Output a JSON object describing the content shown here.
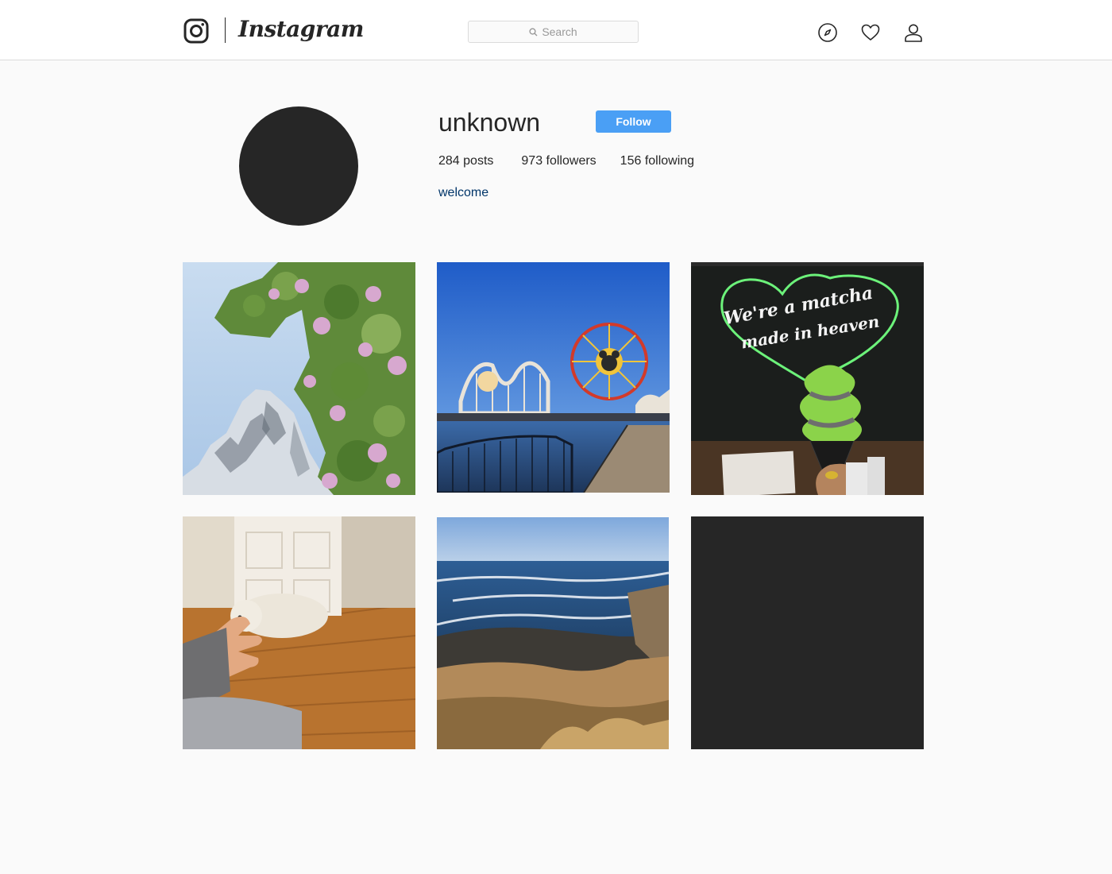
{
  "header": {
    "brand_name": "Instagram",
    "search_placeholder": "Search",
    "icons": [
      "instagram-logo-icon",
      "search-icon",
      "compass-icon",
      "heart-icon",
      "user-icon"
    ]
  },
  "profile": {
    "username": "unknown",
    "follow_label": "Follow",
    "stats": {
      "posts": "284 posts",
      "followers": "973 followers",
      "following": "156 following"
    },
    "bio": "welcome"
  },
  "posts": [
    {
      "subject": "snowy mountain peak with pink blossoms"
    },
    {
      "subject": "amusement park pier with ferris wheel and roller coaster"
    },
    {
      "subject": "green neon heart sign with matcha soft serve cone",
      "sign_text": [
        "We're a matcha",
        "made in heaven"
      ]
    },
    {
      "subject": "fluffy dog lying on a wooden floor"
    },
    {
      "subject": "ocean waves on a rocky beach"
    },
    {
      "subject": "empty dark post"
    }
  ],
  "colors": {
    "follow_button": "#4a9ff5",
    "bio_link": "#003569",
    "avatar": "#262626",
    "background": "#fafafa"
  }
}
